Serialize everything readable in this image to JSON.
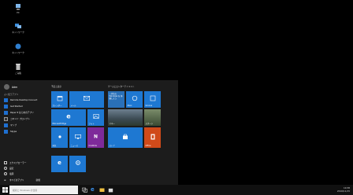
{
  "desktop": {
    "icons": [
      {
        "label": "PC"
      },
      {
        "label": "ネットワーク"
      },
      {
        "label": "ごみ箱"
      }
    ]
  },
  "start_menu": {
    "user": "Adm",
    "recent_title": "よく使うアプリ",
    "apps": [
      {
        "label": "Remote Desktop Connect"
      },
      {
        "label": "Get Started"
      },
      {
        "label": "Paper 8 はじめのアプリ"
      },
      {
        "label": "コマンド プロンプト"
      },
      {
        "label": "マップ"
      },
      {
        "label": "Skype"
      }
    ],
    "system": [
      {
        "label": "エクスプローラー"
      },
      {
        "label": "設定"
      },
      {
        "label": "電源"
      },
      {
        "label": "すべてのアプリ"
      }
    ],
    "all_apps_badge": "新規",
    "group1_title": "予定と表示",
    "group2_title": "ゲームとエンターテイメント",
    "tiles": [
      {
        "label": "カレンダー"
      },
      {
        "label": "メール"
      },
      {
        "label": "Microsoft Edge"
      },
      {
        "label": "フォト"
      },
      {
        "label": "天気"
      },
      {
        "label": "ニュース"
      },
      {
        "label": "OneNote"
      },
      {
        "label": "ストア"
      },
      {
        "label": "Office"
      },
      {
        "label": "Xbox"
      },
      {
        "label": "Groove"
      },
      {
        "label": "映画"
      },
      {
        "label": "マネー"
      },
      {
        "label": "スポーツ"
      }
    ],
    "promo_tile_text": "一歩先の Windows を 体験しよう"
  },
  "taskbar": {
    "search_placeholder": "検索と Windows の仕様",
    "tray_time": "10:38",
    "tray_date": "2016/11/15"
  },
  "colors": {
    "tile_blue": "#1e78d2",
    "tile_purple": "#7e2a9a",
    "tile_orange": "#d04a1a",
    "tile_green": "#2a8a44",
    "start_bg": "#1c1c1c"
  }
}
